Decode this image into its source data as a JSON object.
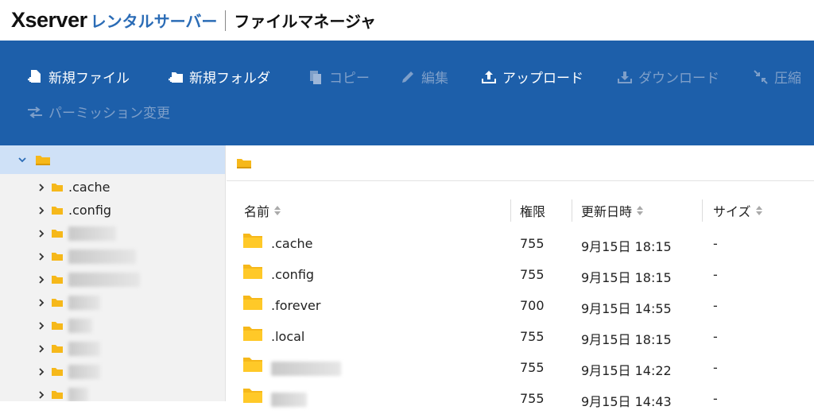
{
  "header": {
    "brand": "Xserver",
    "brand_sub": "レンタルサーバー",
    "app_title": "ファイルマネージャ"
  },
  "toolbar": {
    "new_file": "新規ファイル",
    "new_folder": "新規フォルダ",
    "copy": "コピー",
    "edit": "編集",
    "upload": "アップロード",
    "download": "ダウンロード",
    "compress": "圧縮",
    "permission": "パーミッション変更"
  },
  "sidebar": {
    "items": [
      ".cache",
      ".config"
    ]
  },
  "table": {
    "headers": {
      "name": "名前",
      "permission": "権限",
      "modified": "更新日時",
      "size": "サイズ"
    },
    "rows": [
      {
        "name": ".cache",
        "permission": "755",
        "modified": "9月15日 18:15",
        "size": "-"
      },
      {
        "name": ".config",
        "permission": "755",
        "modified": "9月15日 18:15",
        "size": "-"
      },
      {
        "name": ".forever",
        "permission": "700",
        "modified": "9月15日 14:55",
        "size": "-"
      },
      {
        "name": ".local",
        "permission": "755",
        "modified": "9月15日 18:15",
        "size": "-"
      },
      {
        "name": "",
        "permission": "755",
        "modified": "9月15日 14:22",
        "size": "-"
      },
      {
        "name": "",
        "permission": "755",
        "modified": "9月15日 14:43",
        "size": "-"
      }
    ]
  },
  "colors": {
    "toolbar_bg": "#1d5faa",
    "brand_blue": "#2b6cb6",
    "folder_yellow": "#f6b81a",
    "selected_bg": "#cfe1f7"
  }
}
